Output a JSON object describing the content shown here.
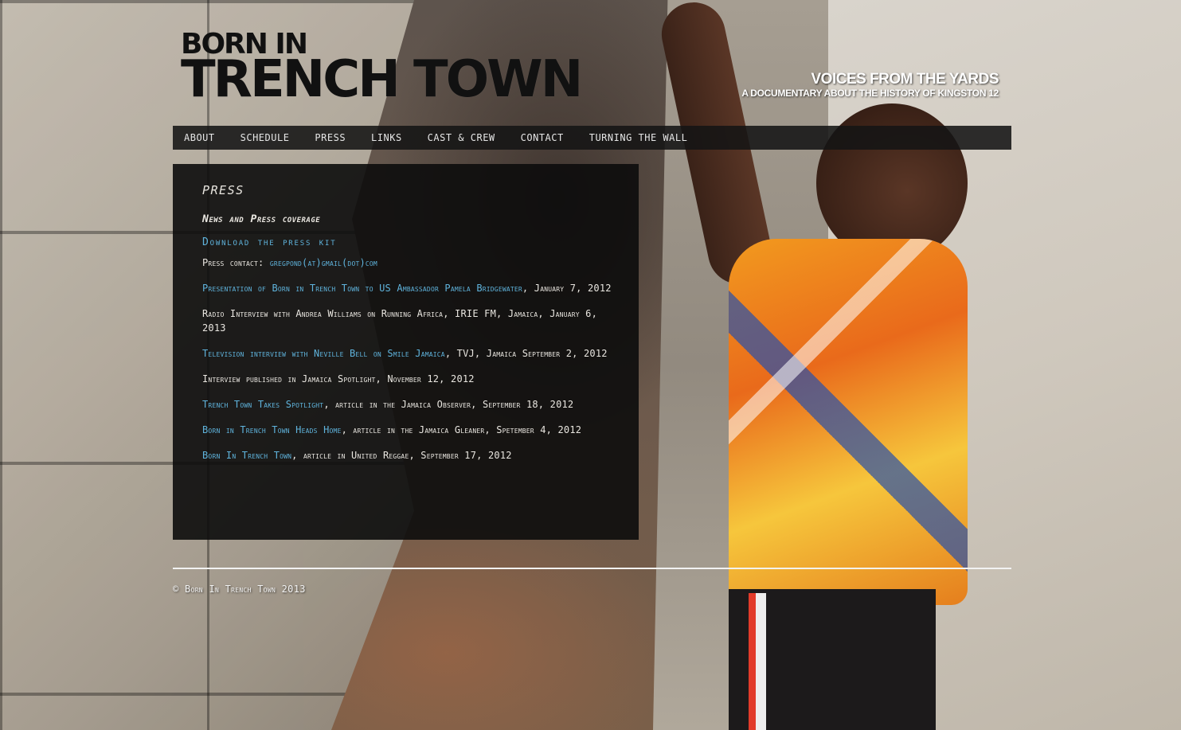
{
  "logo": {
    "line1": "BORN IN",
    "line2": "TRENCH TOWN"
  },
  "tagline": {
    "main": "VOICES FROM THE YARDS",
    "sub": "A DOCUMENTARY ABOUT THE HISTORY OF KINGSTON 12"
  },
  "nav": {
    "items": [
      {
        "label": "About"
      },
      {
        "label": "Schedule"
      },
      {
        "label": "Press"
      },
      {
        "label": "Links"
      },
      {
        "label": "Cast & Crew"
      },
      {
        "label": "Contact"
      },
      {
        "label": "Turning the Wall"
      }
    ]
  },
  "main": {
    "title": "Press",
    "subtitle": "News and Press coverage",
    "kit_link": "Download the press kit",
    "contact_label": "Press contact:",
    "contact_email": "gregpond(at)gmail(dot)com",
    "entries": [
      {
        "link": "Presentation of Born in Trench Town to US Ambassador Pamela Bridgewater",
        "text": ", January 7, 2012"
      },
      {
        "link": "",
        "text": "Radio Interview with Andrea Williams on Running Africa, IRIE FM, Jamaica, January 6, 2013"
      },
      {
        "link": "Television interview with Neville Bell on Smile Jamaica",
        "text": ", TVJ, Jamaica September 2, 2012"
      },
      {
        "link": "",
        "text": "Interview published in Jamaica Spotlight, November 12, 2012"
      },
      {
        "link": "Trench Town Takes Spotlight",
        "text": ", article in the Jamaica Observer, September 18, 2012"
      },
      {
        "link": "Born in Trench Town Heads Home",
        "text": ", article in the Jamaica Gleaner, Spetember 4, 2012"
      },
      {
        "link": "Born In Trench Town",
        "text": ", article in United Reggae, September 17, 2012"
      }
    ]
  },
  "footer": {
    "copyright": "© Born In Trench Town 2013"
  },
  "colors": {
    "link": "#5fb3dc",
    "panel": "#0c0c0c",
    "nav_bar": "#141414"
  }
}
